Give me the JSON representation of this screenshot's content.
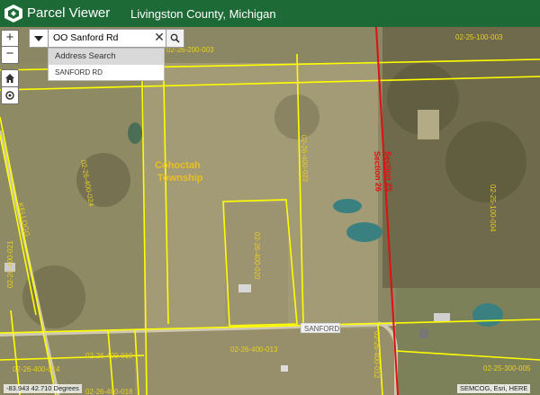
{
  "header": {
    "app_title": "Parcel Viewer",
    "county": "Livingston County, Michigan",
    "bg": "#1e6a36"
  },
  "controls": {
    "zoom_in": "+",
    "zoom_out": "−",
    "home_icon": "home-icon",
    "locate_icon": "locate-icon"
  },
  "search": {
    "value": "OO Sanford Rd",
    "clear": "✕",
    "dropdown_icon": "caret-down-icon",
    "button_icon": "search-icon"
  },
  "suggestions": {
    "header": "Address Search",
    "items": [
      "SANFORD RD"
    ]
  },
  "map": {
    "township": [
      "Cohoctah",
      "Township"
    ],
    "road": "SANFORD",
    "section_label": [
      "Section 26",
      "Section 25"
    ],
    "parcels": [
      "02-26-200-003",
      "02-25-100-003",
      "02-26-400-024",
      "02-26-400-022",
      "02-26-400-020",
      "02-26-400-019",
      "02-26-400-014",
      "02-26-400-013",
      "02-26-400-018",
      "02-26-400-012",
      "02-25-100-004",
      "02-25-300-005",
      "KELLOGG",
      "02-26-400-021"
    ],
    "parcel_color": "#ffff00",
    "section_color": "#e01010",
    "label_color": "#e8d020"
  },
  "status": {
    "coords": "-83.943 42.710 Degrees",
    "attribution": "SEMCOG, Esri, HERE"
  }
}
